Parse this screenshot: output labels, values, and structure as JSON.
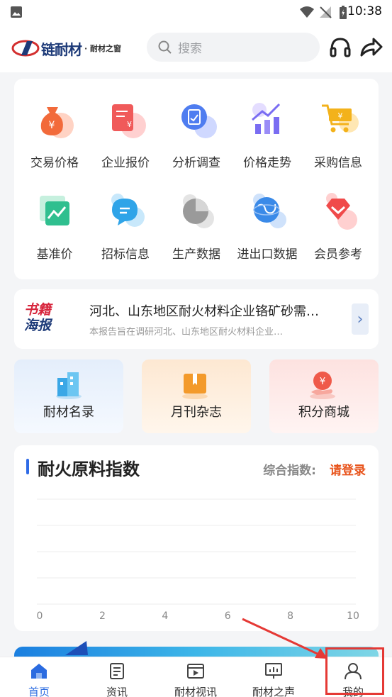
{
  "status_bar": {
    "time": "10:38"
  },
  "header": {
    "logo_brand": "链耐材",
    "logo_sub": "· 耐材之窗",
    "search_placeholder": "搜索"
  },
  "grid_items": [
    {
      "label": "交易价格",
      "icon": "money-bag-icon",
      "color": "#f26a3a"
    },
    {
      "label": "企业报价",
      "icon": "invoice-icon",
      "color": "#f05a5a"
    },
    {
      "label": "分析调查",
      "icon": "report-analysis-icon",
      "color": "#4f7df0"
    },
    {
      "label": "价格走势",
      "icon": "trend-chart-icon",
      "color": "#7a6df2"
    },
    {
      "label": "采购信息",
      "icon": "shopping-cart-icon",
      "color": "#f3b21b"
    },
    {
      "label": "基准价",
      "icon": "benchmark-chart-icon",
      "color": "#2fbf8f"
    },
    {
      "label": "招标信息",
      "icon": "chat-bubble-icon",
      "color": "#2fa4e8"
    },
    {
      "label": "生产数据",
      "icon": "pie-chart-icon",
      "color": "#9a9a9a"
    },
    {
      "label": "进出口数据",
      "icon": "globe-icon",
      "color": "#3a8ae8"
    },
    {
      "label": "会员参考",
      "icon": "vip-badge-icon",
      "color": "#f04a4a"
    }
  ],
  "news": {
    "badge_line1": "书籍",
    "badge_line2": "海报",
    "title": "河北、山东地区耐火材料企业铬矿砂需…",
    "desc": "本报告旨在调研河北、山东地区耐火材料企业…"
  },
  "feature_cards": [
    {
      "label": "耐材名录",
      "icon": "building-icon",
      "bg": "#eaf2fb"
    },
    {
      "label": "月刊杂志",
      "icon": "book-icon",
      "bg": "#fdf0e2"
    },
    {
      "label": "积分商城",
      "icon": "coin-hand-icon",
      "bg": "#fdeceb"
    }
  ],
  "index_section": {
    "title": "耐火原料指数",
    "index_label": "综合指数:",
    "login_link": "请登录"
  },
  "chart_data": {
    "type": "line",
    "x_ticks": [
      "0",
      "2",
      "4",
      "6",
      "8",
      "10"
    ],
    "xlim": [
      0,
      10
    ],
    "series": [],
    "grid": true
  },
  "tabs": [
    {
      "label": "首页",
      "icon": "home-icon",
      "active": true
    },
    {
      "label": "资讯",
      "icon": "news-doc-icon",
      "active": false
    },
    {
      "label": "耐材视讯",
      "icon": "video-icon",
      "active": false
    },
    {
      "label": "耐材之声",
      "icon": "presentation-icon",
      "active": false
    },
    {
      "label": "我的",
      "icon": "user-icon",
      "active": false
    }
  ]
}
